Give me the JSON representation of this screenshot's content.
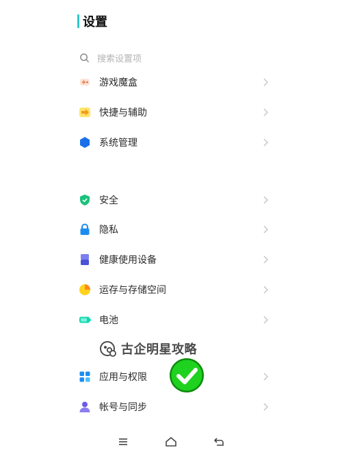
{
  "header": {
    "title": "设置"
  },
  "search": {
    "placeholder": "搜索设置项"
  },
  "groups": [
    {
      "items": [
        {
          "label": "游戏魔盒",
          "icon": "game-box-icon"
        },
        {
          "label": "快捷与辅助",
          "icon": "shortcut-arrow-icon"
        },
        {
          "label": "系统管理",
          "icon": "system-hexagon-icon"
        }
      ]
    },
    {
      "items": [
        {
          "label": "安全",
          "icon": "shield-icon"
        },
        {
          "label": "隐私",
          "icon": "lock-icon"
        },
        {
          "label": "健康使用设备",
          "icon": "hourglass-icon"
        },
        {
          "label": "运存与存储空间",
          "icon": "storage-pie-icon"
        },
        {
          "label": "电池",
          "icon": "battery-icon"
        },
        {
          "label": "应用与权限",
          "icon": "apps-grid-icon"
        },
        {
          "label": "帐号与同步",
          "icon": "account-icon"
        }
      ]
    }
  ],
  "watermark": {
    "text": "古企明星攻略"
  },
  "navbar": {
    "buttons": [
      "menu-icon",
      "home-icon",
      "back-icon"
    ]
  },
  "colors": {
    "accent": "#2ec7c9",
    "check_green": "#1fd21f",
    "chevron": "#c8c8c8"
  }
}
